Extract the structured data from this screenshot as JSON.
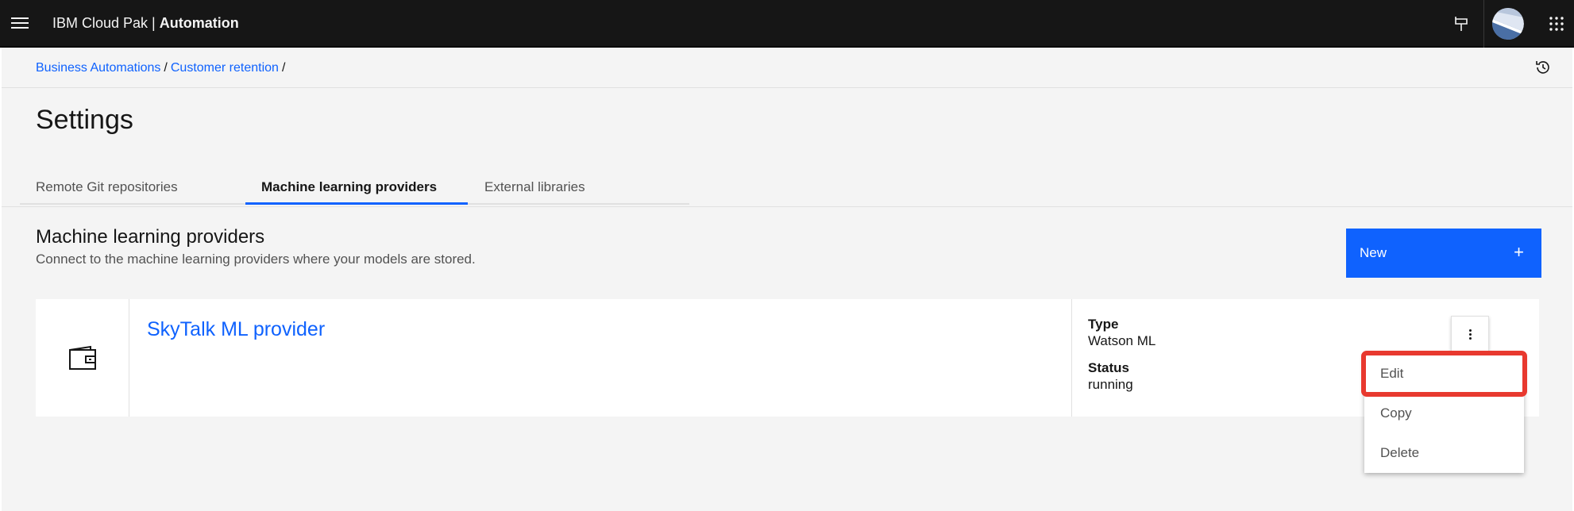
{
  "header": {
    "brand_prefix": "IBM Cloud Pak | ",
    "brand_product": "Automation",
    "icons": [
      "menu-icon",
      "pin-icon",
      "avatar",
      "app-switcher-icon"
    ]
  },
  "breadcrumb": {
    "items": [
      "Business Automations",
      "Customer retention"
    ],
    "separator": "/"
  },
  "page": {
    "title": "Settings"
  },
  "tabs": [
    {
      "label": "Remote Git repositories",
      "active": false
    },
    {
      "label": "Machine learning providers",
      "active": true
    },
    {
      "label": "External libraries",
      "active": false
    }
  ],
  "section": {
    "title": "Machine learning providers",
    "description": "Connect to the machine learning providers where your models are stored.",
    "new_button": "New",
    "new_button_icon": "+"
  },
  "provider": {
    "name": "SkyTalk ML provider",
    "icon": "wallet-icon",
    "type_label": "Type",
    "type_value": "Watson ML",
    "status_label": "Status",
    "status_value": "running"
  },
  "overflow_menu": {
    "items": [
      "Edit",
      "Copy",
      "Delete"
    ],
    "highlighted": "Edit"
  },
  "colors": {
    "header_bg": "#161616",
    "accent": "#0f62fe",
    "highlight": "#e8392f",
    "page_bg": "#f4f4f4"
  }
}
